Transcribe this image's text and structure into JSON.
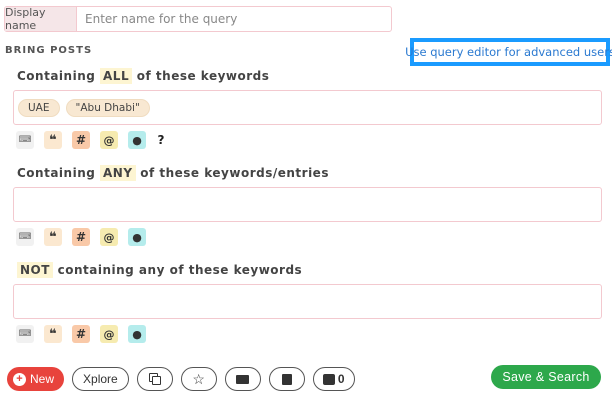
{
  "display": {
    "label": "Display name",
    "placeholder": "Enter name for the query"
  },
  "bring_posts": "BRING POSTS",
  "advanced_link": "Use query editor for advanced users",
  "sections": [
    {
      "pre": "Containing ",
      "hl": "ALL",
      "post": " of these keywords",
      "chips": [
        "UAE",
        "\"Abu Dhabi\""
      ],
      "has_help": true
    },
    {
      "pre": "Containing ",
      "hl": "ANY",
      "post": " of these keywords/entries",
      "chips": [],
      "has_help": false
    },
    {
      "pre": "",
      "hl": "NOT",
      "post": " containing any of these keywords",
      "chips": [],
      "has_help": false
    }
  ],
  "icons": {
    "keyboard": "⌨",
    "quote": "❝",
    "hash": "#",
    "at": "@",
    "globe": "●",
    "help": "?"
  },
  "bottom": {
    "new_plus": "+",
    "new_label": "New",
    "xplore_label": "Xplore",
    "star": "☆",
    "image_count": "0",
    "save_search": "Save & Search"
  },
  "colors": {
    "new_button": "#e8433c",
    "save_button": "#2da84b",
    "link": "#2a79d0",
    "highlight_border": "#1a9bff"
  }
}
